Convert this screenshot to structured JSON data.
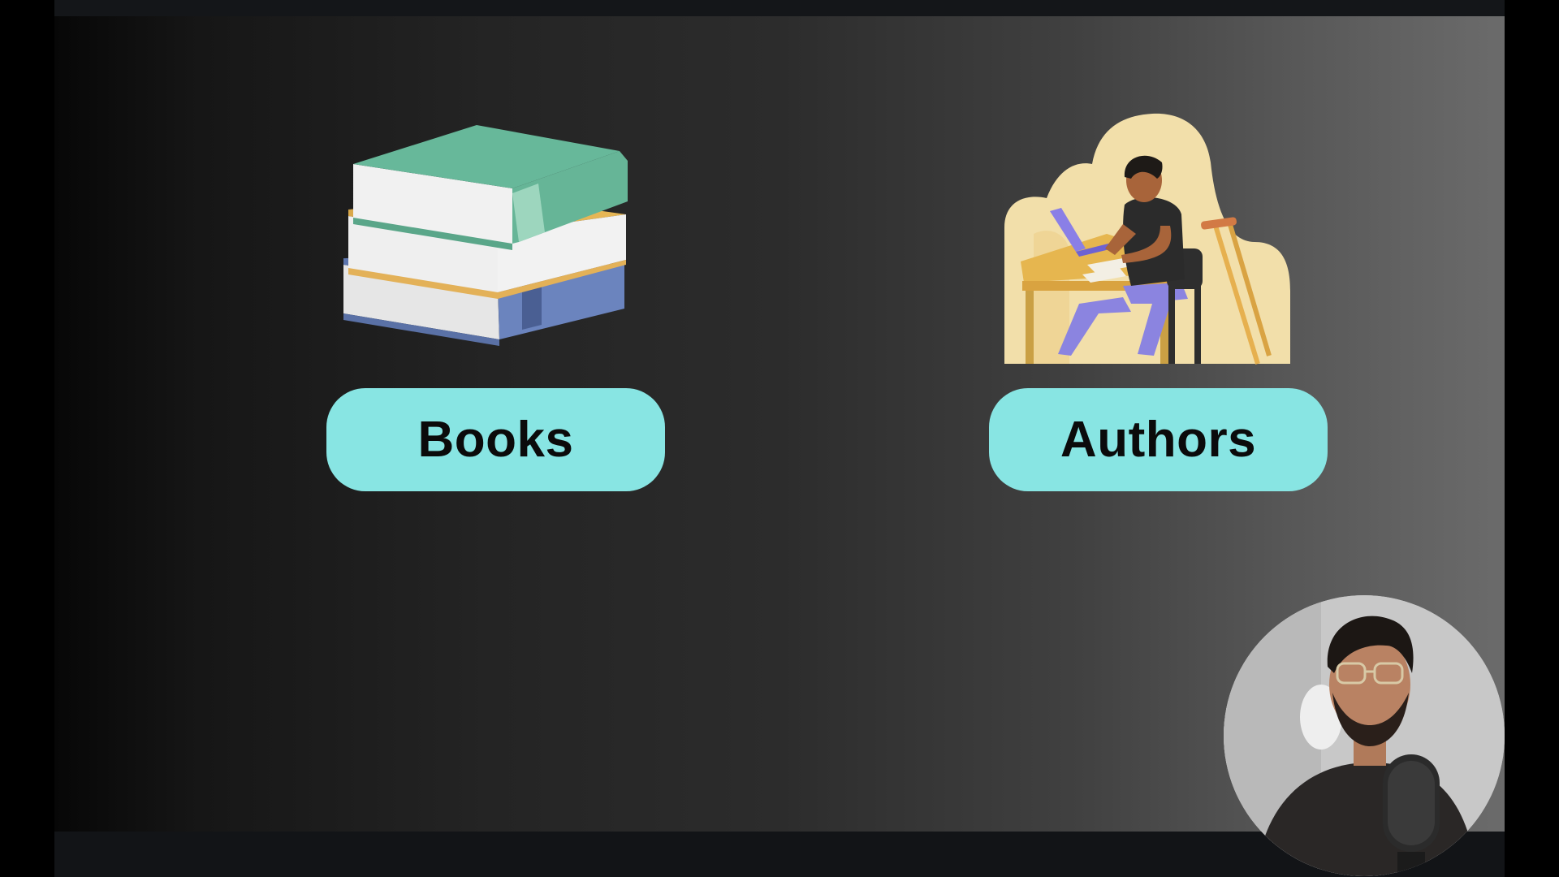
{
  "slide": {
    "items": [
      {
        "label": "Books",
        "icon": "books-stack-icon"
      },
      {
        "label": "Authors",
        "icon": "author-writing-icon"
      }
    ],
    "pill_color": "#88e5e3",
    "text_color": "#0b0b0b"
  },
  "presenter": {
    "icon": "presenter-webcam"
  }
}
